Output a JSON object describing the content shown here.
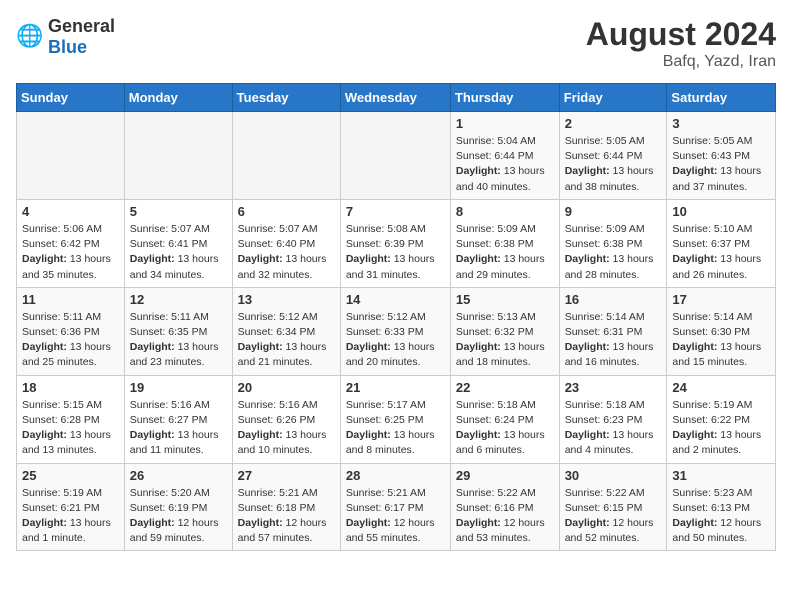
{
  "logo": {
    "text_general": "General",
    "text_blue": "Blue"
  },
  "title": "August 2024",
  "subtitle": "Bafq, Yazd, Iran",
  "days_of_week": [
    "Sunday",
    "Monday",
    "Tuesday",
    "Wednesday",
    "Thursday",
    "Friday",
    "Saturday"
  ],
  "weeks": [
    [
      {
        "day": "",
        "info": ""
      },
      {
        "day": "",
        "info": ""
      },
      {
        "day": "",
        "info": ""
      },
      {
        "day": "",
        "info": ""
      },
      {
        "day": "1",
        "info": "Sunrise: 5:04 AM\nSunset: 6:44 PM\nDaylight: 13 hours and 40 minutes."
      },
      {
        "day": "2",
        "info": "Sunrise: 5:05 AM\nSunset: 6:44 PM\nDaylight: 13 hours and 38 minutes."
      },
      {
        "day": "3",
        "info": "Sunrise: 5:05 AM\nSunset: 6:43 PM\nDaylight: 13 hours and 37 minutes."
      }
    ],
    [
      {
        "day": "4",
        "info": "Sunrise: 5:06 AM\nSunset: 6:42 PM\nDaylight: 13 hours and 35 minutes."
      },
      {
        "day": "5",
        "info": "Sunrise: 5:07 AM\nSunset: 6:41 PM\nDaylight: 13 hours and 34 minutes."
      },
      {
        "day": "6",
        "info": "Sunrise: 5:07 AM\nSunset: 6:40 PM\nDaylight: 13 hours and 32 minutes."
      },
      {
        "day": "7",
        "info": "Sunrise: 5:08 AM\nSunset: 6:39 PM\nDaylight: 13 hours and 31 minutes."
      },
      {
        "day": "8",
        "info": "Sunrise: 5:09 AM\nSunset: 6:38 PM\nDaylight: 13 hours and 29 minutes."
      },
      {
        "day": "9",
        "info": "Sunrise: 5:09 AM\nSunset: 6:38 PM\nDaylight: 13 hours and 28 minutes."
      },
      {
        "day": "10",
        "info": "Sunrise: 5:10 AM\nSunset: 6:37 PM\nDaylight: 13 hours and 26 minutes."
      }
    ],
    [
      {
        "day": "11",
        "info": "Sunrise: 5:11 AM\nSunset: 6:36 PM\nDaylight: 13 hours and 25 minutes."
      },
      {
        "day": "12",
        "info": "Sunrise: 5:11 AM\nSunset: 6:35 PM\nDaylight: 13 hours and 23 minutes."
      },
      {
        "day": "13",
        "info": "Sunrise: 5:12 AM\nSunset: 6:34 PM\nDaylight: 13 hours and 21 minutes."
      },
      {
        "day": "14",
        "info": "Sunrise: 5:12 AM\nSunset: 6:33 PM\nDaylight: 13 hours and 20 minutes."
      },
      {
        "day": "15",
        "info": "Sunrise: 5:13 AM\nSunset: 6:32 PM\nDaylight: 13 hours and 18 minutes."
      },
      {
        "day": "16",
        "info": "Sunrise: 5:14 AM\nSunset: 6:31 PM\nDaylight: 13 hours and 16 minutes."
      },
      {
        "day": "17",
        "info": "Sunrise: 5:14 AM\nSunset: 6:30 PM\nDaylight: 13 hours and 15 minutes."
      }
    ],
    [
      {
        "day": "18",
        "info": "Sunrise: 5:15 AM\nSunset: 6:28 PM\nDaylight: 13 hours and 13 minutes."
      },
      {
        "day": "19",
        "info": "Sunrise: 5:16 AM\nSunset: 6:27 PM\nDaylight: 13 hours and 11 minutes."
      },
      {
        "day": "20",
        "info": "Sunrise: 5:16 AM\nSunset: 6:26 PM\nDaylight: 13 hours and 10 minutes."
      },
      {
        "day": "21",
        "info": "Sunrise: 5:17 AM\nSunset: 6:25 PM\nDaylight: 13 hours and 8 minutes."
      },
      {
        "day": "22",
        "info": "Sunrise: 5:18 AM\nSunset: 6:24 PM\nDaylight: 13 hours and 6 minutes."
      },
      {
        "day": "23",
        "info": "Sunrise: 5:18 AM\nSunset: 6:23 PM\nDaylight: 13 hours and 4 minutes."
      },
      {
        "day": "24",
        "info": "Sunrise: 5:19 AM\nSunset: 6:22 PM\nDaylight: 13 hours and 2 minutes."
      }
    ],
    [
      {
        "day": "25",
        "info": "Sunrise: 5:19 AM\nSunset: 6:21 PM\nDaylight: 13 hours and 1 minute."
      },
      {
        "day": "26",
        "info": "Sunrise: 5:20 AM\nSunset: 6:19 PM\nDaylight: 12 hours and 59 minutes."
      },
      {
        "day": "27",
        "info": "Sunrise: 5:21 AM\nSunset: 6:18 PM\nDaylight: 12 hours and 57 minutes."
      },
      {
        "day": "28",
        "info": "Sunrise: 5:21 AM\nSunset: 6:17 PM\nDaylight: 12 hours and 55 minutes."
      },
      {
        "day": "29",
        "info": "Sunrise: 5:22 AM\nSunset: 6:16 PM\nDaylight: 12 hours and 53 minutes."
      },
      {
        "day": "30",
        "info": "Sunrise: 5:22 AM\nSunset: 6:15 PM\nDaylight: 12 hours and 52 minutes."
      },
      {
        "day": "31",
        "info": "Sunrise: 5:23 AM\nSunset: 6:13 PM\nDaylight: 12 hours and 50 minutes."
      }
    ]
  ]
}
